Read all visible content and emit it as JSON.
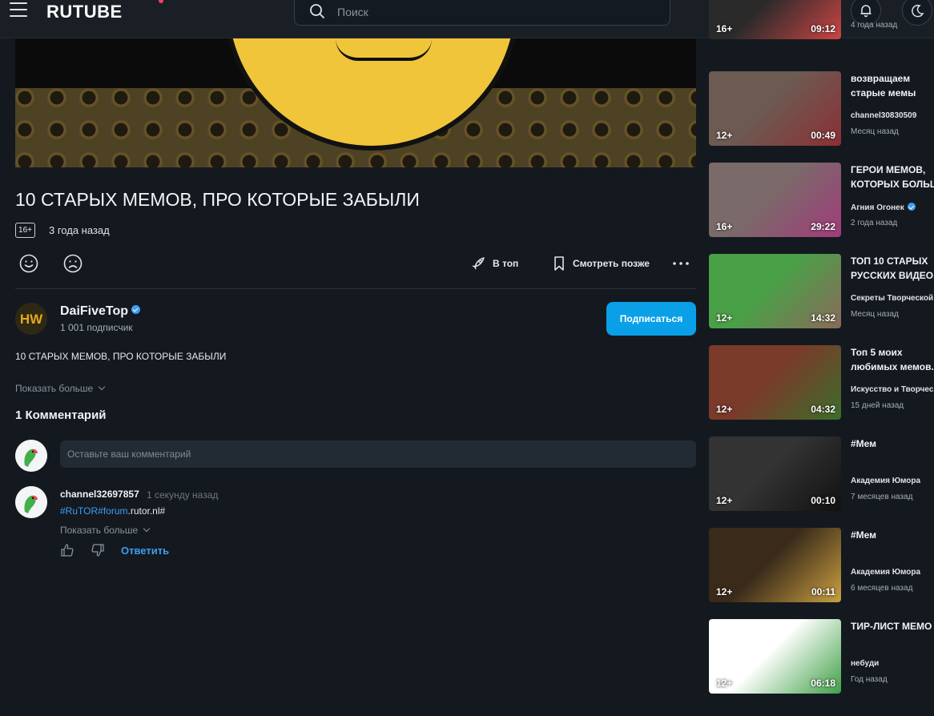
{
  "header": {
    "logo": "RUTUBE",
    "search_placeholder": "Поиск"
  },
  "video": {
    "title": "10 СТАРЫХ МЕМОВ, ПРО КОТОРЫЕ ЗАБЫЛИ",
    "age_rating": "16+",
    "posted": "3 года назад",
    "actions": {
      "to_top": "В топ",
      "watch_later": "Смотреть позже"
    },
    "description": "10 СТАРЫХ МЕМОВ, ПРО КОТОРЫЕ ЗАБЫЛИ",
    "show_more": "Показать больше"
  },
  "channel": {
    "name": "DaiFiveTop",
    "avatar_text": "HW",
    "subscribers": "1 001 подписчик",
    "subscribe_label": "Подписаться"
  },
  "comments": {
    "title": "1 Комментарий",
    "input_placeholder": "Оставьте ваш комментарий",
    "items": [
      {
        "author": "channel32697857",
        "time": "1 секунду назад",
        "text_link1": "#RuTOR",
        "text_link2": "#forum",
        "text_tail": ".rutor.nl#",
        "show_more": "Показать больше",
        "reply": "Ответить"
      }
    ]
  },
  "recommendations": [
    {
      "age": "16+",
      "duration": "09:12",
      "title": [],
      "channel": "",
      "date": "4 года назад",
      "colors": [
        "#2a2a2a",
        "#c44"
      ]
    },
    {
      "age": "12+",
      "duration": "00:49",
      "title": [
        "возвращаем",
        "старые мемы"
      ],
      "channel": "channel30830509",
      "date": "Месяц назад",
      "colors": [
        "#6d5a52",
        "#8b2f35"
      ]
    },
    {
      "age": "16+",
      "duration": "29:22",
      "title": [
        "ГЕРОИ МЕМОВ,",
        "КОТОРЫХ БОЛЬШ"
      ],
      "channel": "Агния Огонек",
      "verified": true,
      "date": "2 года назад",
      "colors": [
        "#7a6a6a",
        "#a23b7a"
      ]
    },
    {
      "age": "12+",
      "duration": "14:32",
      "title": [
        "ТОП 10 СТАРЫХ",
        "РУССКИХ ВИДЕО."
      ],
      "channel": "Секреты Творческой",
      "date": "Месяц назад",
      "colors": [
        "#4aa047",
        "#8a6a5a"
      ]
    },
    {
      "age": "12+",
      "duration": "04:32",
      "title": [
        "Топ 5 моих",
        "любимых мемов."
      ],
      "channel": "Искусство и Творчес",
      "date": "15 дней назад",
      "colors": [
        "#7a3a2a",
        "#3c6e2a"
      ]
    },
    {
      "age": "12+",
      "duration": "00:10",
      "title": [
        "#Мем"
      ],
      "channel": "Академия Юмора",
      "date": "7 месяцев назад",
      "colors": [
        "#333",
        "#111"
      ]
    },
    {
      "age": "12+",
      "duration": "00:11",
      "title": [
        "#Мем"
      ],
      "channel": "Академия Юмора",
      "date": "6 месяцев назад",
      "colors": [
        "#3a2a1a",
        "#c9a040"
      ]
    },
    {
      "age": "12+",
      "duration": "06:18",
      "title": [
        "ТИР-ЛИСТ МЕМО"
      ],
      "channel": "небуди",
      "date": "Год назад",
      "colors": [
        "#fff",
        "#3fa046"
      ]
    }
  ]
}
